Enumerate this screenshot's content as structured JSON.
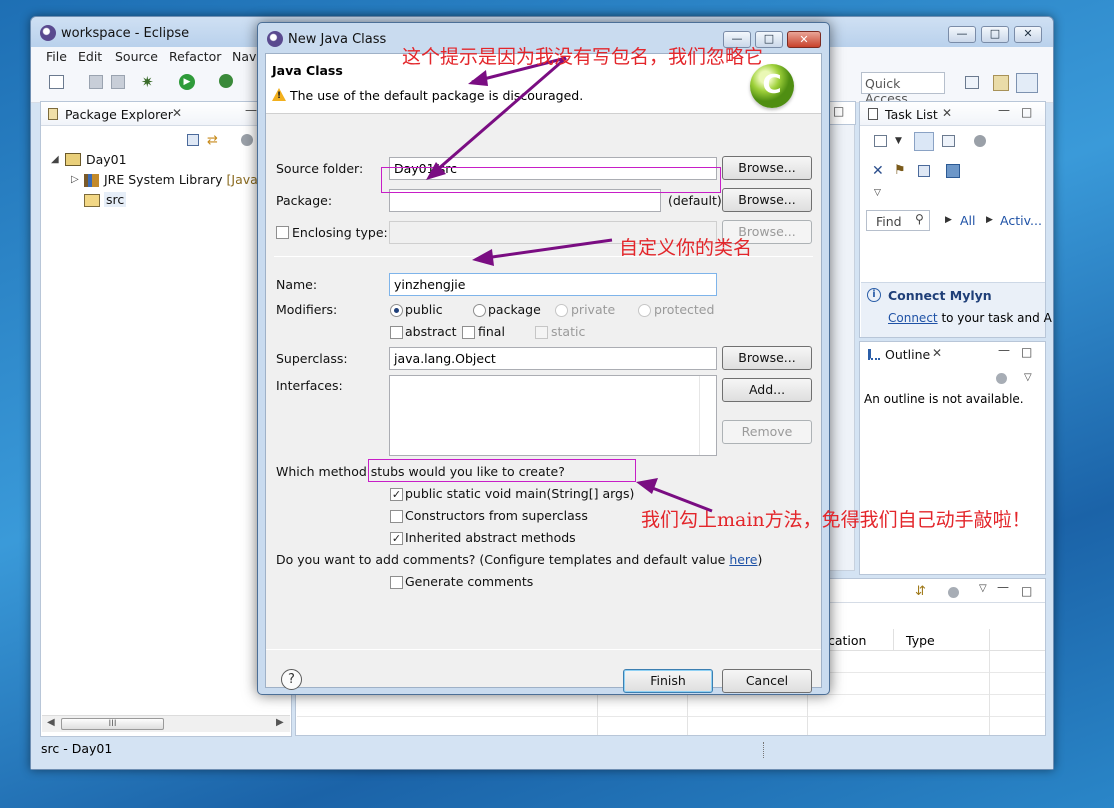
{
  "eclipse": {
    "title": "workspace - Eclipse",
    "menu": [
      "File",
      "Edit",
      "Source",
      "Refactor",
      "Navi"
    ],
    "quick_access": "Quick Access",
    "package_explorer": {
      "tab": "Package Explorer",
      "project": "Day01",
      "jre": "JRE System Library",
      "jre_suffix": "[JavaSE",
      "src": "src",
      "scroll_mid": "III"
    },
    "task_list": {
      "tab": "Task List",
      "find_placeholder": "Find",
      "all": "All",
      "activate": "Activ..."
    },
    "mylyn": {
      "title": "Connect Mylyn",
      "link": "Connect",
      "rest": " to your task and A"
    },
    "outline": {
      "tab": "Outline",
      "message": "An outline is not available."
    },
    "bottom_panel": {
      "col_location": "cation",
      "col_type": "Type"
    },
    "status": "src - Day01"
  },
  "dialog": {
    "title": "New Java Class",
    "heading": "Java Class",
    "warning": "The use of the default package is discouraged.",
    "source_folder_label": "Source folder:",
    "source_folder_value": "Day01/src",
    "package_label": "Package:",
    "package_value": "",
    "package_default": "(default)",
    "enclosing_label": "Enclosing type:",
    "name_label": "Name:",
    "name_value": "yinzhengjie",
    "modifiers_label": "Modifiers:",
    "mod_public": "public",
    "mod_package": "package",
    "mod_private": "private",
    "mod_protected": "protected",
    "mod_abstract": "abstract",
    "mod_final": "final",
    "mod_static": "static",
    "superclass_label": "Superclass:",
    "superclass_value": "java.lang.Object",
    "interfaces_label": "Interfaces:",
    "browse": "Browse...",
    "add": "Add...",
    "remove": "Remove",
    "stubs_question": "Which method stubs would you like to create?",
    "stub_main": "public static void main(String[] args)",
    "stub_constructors": "Constructors from superclass",
    "stub_inherited": "Inherited abstract methods",
    "comments_question": "Do you want to add comments? (Configure templates and default value ",
    "comments_link": "here",
    "comments_close": ")",
    "generate_comments": "Generate comments",
    "finish": "Finish",
    "cancel": "Cancel",
    "help": "?"
  },
  "annotations": {
    "note1": "这个提示是因为我没有写包名，我们忽略它",
    "note2": "自定义你的类名",
    "note3": "我们勾上main方法，免得我们自己动手敲啦！"
  },
  "colors": {
    "annotation": "#e3262b",
    "arrow": "#7a0d82",
    "highlight": "#c71ec7"
  }
}
